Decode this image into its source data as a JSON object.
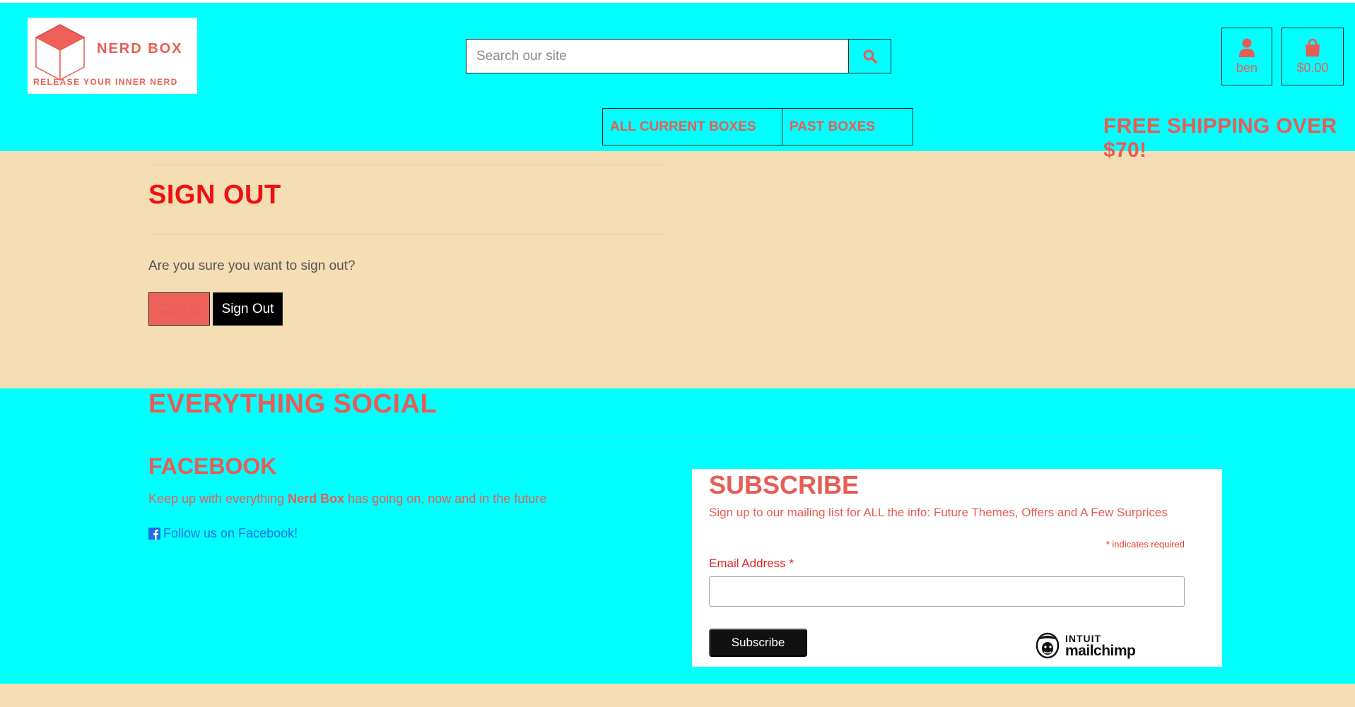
{
  "header": {
    "logo": {
      "brand": "NERD BOX",
      "tagline": "RELEASE YOUR INNER NERD"
    },
    "search": {
      "placeholder": "Search our site",
      "icon": "search-icon"
    },
    "account": {
      "username": "ben",
      "icon": "user-icon"
    },
    "bag": {
      "total": "$0.00",
      "icon": "shopping-bag-icon"
    },
    "nav": {
      "current_boxes": "ALL CURRENT BOXES",
      "past_boxes": "PAST BOXES"
    },
    "banner": "FREE SHIPPING OVER $70!"
  },
  "main": {
    "title": "SIGN OUT",
    "confirm_text": "Are you sure you want to sign out?",
    "cancel_label": "Cancel",
    "signout_label": "Sign Out"
  },
  "footer": {
    "title": "EVERYTHING SOCIAL",
    "facebook": {
      "heading": "FACEBOOK",
      "text_before": "Keep up with everything ",
      "brand": "Nerd Box",
      "text_after": " has going on, now and in the future",
      "link": "Follow us on Facebook!"
    },
    "subscribe": {
      "title": "SUBSCRIBE",
      "description": "Sign up to our mailing list for ALL the info: Future Themes, Offers and A Few Surprices",
      "required_marker": "*",
      "required_note": " indicates required",
      "email_label": "Email Address",
      "email_required": "*",
      "button": "Subscribe",
      "badge_top": "INTUIT",
      "badge_bottom": "mailchimp"
    }
  },
  "colors": {
    "cyan": "#00ffff",
    "wheat": "#f5deb3",
    "coral": "#e85c55",
    "red": "#ee1111"
  }
}
